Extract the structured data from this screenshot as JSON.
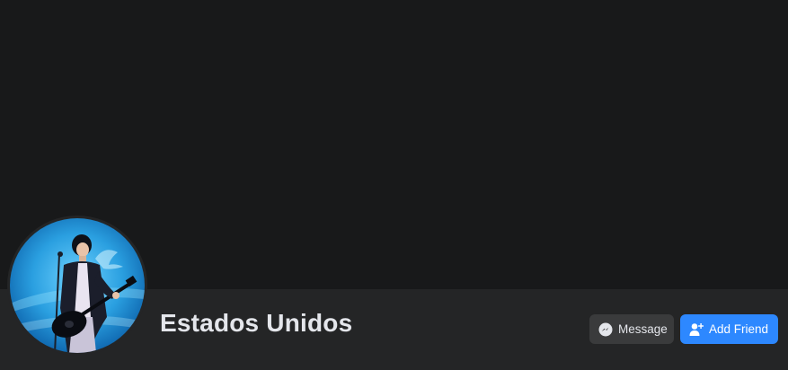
{
  "profile": {
    "name": "Estados Unidos"
  },
  "actions": {
    "message_label": "Message",
    "message_icon": "messenger-icon",
    "add_friend_label": "Add Friend",
    "add_friend_icon": "add-friend-icon"
  },
  "colors": {
    "background": "#18191a",
    "header_bar": "#242526",
    "secondary_button": "#3a3b3c",
    "primary_button": "#2d88ff",
    "text": "#e4e6eb"
  }
}
